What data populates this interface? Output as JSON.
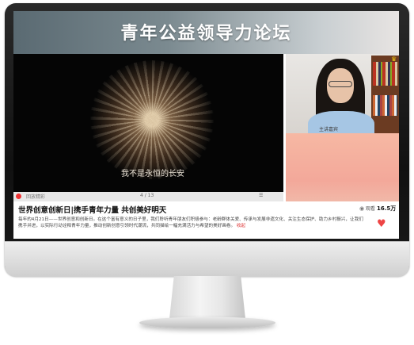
{
  "banner": {
    "title": "青年公益领导力论坛"
  },
  "video": {
    "subtitle": "我不是永恒的长安",
    "controls": {
      "left_label": "回放精彩",
      "page": "4 / 13",
      "right_label": "☰"
    }
  },
  "webcam": {
    "name_label": "主讲嘉宾"
  },
  "article": {
    "title": "世界创意创新日|携手青年力量 共创美好明天",
    "views_label": "观看",
    "views_count": "16.5万",
    "description": "每年的4月21日——世界创意和创新日。在这个富有意义的日子里，我们聆听青年朋友们积极参与：老龄群体关爱、传承与发展非遗文化、关注生态保护、助力乡村振兴，让我们携手并进，以实际行动诠释青年力量，推动创新创意引领时代潮流，共同描绘一幅充满活力与希望的美好画卷。",
    "more": "收起"
  },
  "colors": {
    "accent": "#e44444",
    "side_panel": "#f3a89a"
  }
}
